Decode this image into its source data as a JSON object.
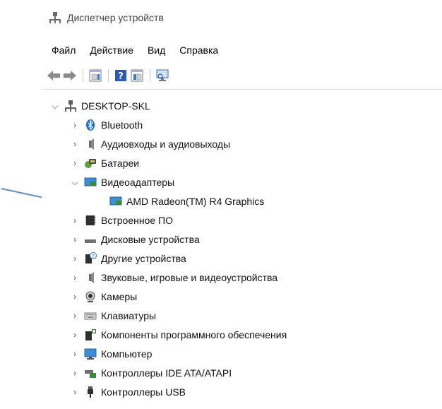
{
  "window": {
    "title": "Диспетчер устройств"
  },
  "menu": {
    "items": [
      "Файл",
      "Действие",
      "Вид",
      "Справка"
    ]
  },
  "toolbar": {
    "buttons": [
      "back-arrow-icon",
      "forward-arrow-icon",
      "properties-icon",
      "help-icon",
      "update-driver-icon",
      "monitor-scan-icon"
    ]
  },
  "tree": {
    "root": {
      "label": "DESKTOP-SKL",
      "expanded": true,
      "icon": "computer-icon"
    },
    "items": [
      {
        "label": "Bluetooth",
        "icon": "bluetooth-icon",
        "expanded": false
      },
      {
        "label": "Аудиовходы и аудиовыходы",
        "icon": "speaker-icon",
        "expanded": false
      },
      {
        "label": "Батареи",
        "icon": "battery-icon",
        "expanded": false
      },
      {
        "label": "Видеоадаптеры",
        "icon": "display-adapter-icon",
        "expanded": true,
        "children": [
          {
            "label": "AMD Radeon(TM) R4 Graphics",
            "icon": "display-adapter-icon"
          }
        ]
      },
      {
        "label": "Встроенное ПО",
        "icon": "firmware-icon",
        "expanded": false
      },
      {
        "label": "Дисковые устройства",
        "icon": "disk-drive-icon",
        "expanded": false
      },
      {
        "label": "Другие устройства",
        "icon": "unknown-device-icon",
        "expanded": false
      },
      {
        "label": "Звуковые, игровые и видеоустройства",
        "icon": "speaker-icon",
        "expanded": false
      },
      {
        "label": "Камеры",
        "icon": "camera-icon",
        "expanded": false
      },
      {
        "label": "Клавиатуры",
        "icon": "keyboard-icon",
        "expanded": false
      },
      {
        "label": "Компоненты программного обеспечения",
        "icon": "software-component-icon",
        "expanded": false
      },
      {
        "label": "Компьютер",
        "icon": "monitor-icon",
        "expanded": false
      },
      {
        "label": "Контроллеры IDE ATA/ATAPI",
        "icon": "ide-controller-icon",
        "expanded": false
      },
      {
        "label": "Контроллеры USB",
        "icon": "usb-icon",
        "expanded": false
      }
    ]
  },
  "annotation": {
    "arrow_color": "#5b8fc7"
  }
}
